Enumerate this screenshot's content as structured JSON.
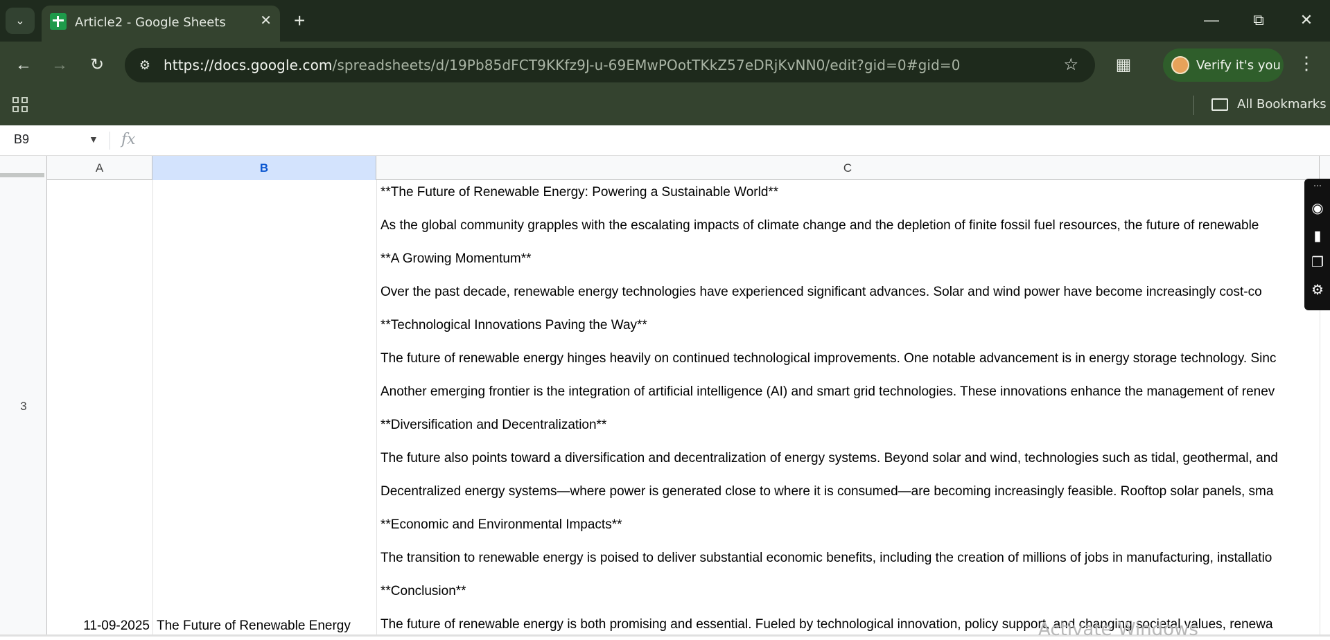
{
  "browser": {
    "tab_title": "Article2 - Google Sheets",
    "url_host": "https://docs.google.com",
    "url_path": "/spreadsheets/d/19Pb85dFCT9KKfz9J-u-69EMwPOotTKkZ57eDRjKvNN0/edit?gid=0#gid=0",
    "verify_label": "Verify it's you",
    "bookmarks_label": "All Bookmarks"
  },
  "sheet": {
    "name_box": "B9",
    "fx_label": "fx",
    "columns": [
      {
        "label": "A"
      },
      {
        "label": "B"
      },
      {
        "label": "C"
      }
    ],
    "row_number": "3",
    "cell_a": "11-09-2025",
    "cell_b": "The Future of Renewable Energy",
    "cell_c_lines": [
      "**The Future of Renewable Energy: Powering a Sustainable World**",
      "As the global community grapples with the escalating impacts of climate change and the depletion of finite fossil fuel resources, the future of renewable",
      "**A Growing Momentum**",
      "Over the past decade, renewable energy technologies have experienced significant advances. Solar and wind power have become increasingly cost-co",
      "**Technological Innovations Paving the Way**",
      "The future of renewable energy hinges heavily on continued technological improvements. One notable advancement is in energy storage technology. Sinc",
      "Another emerging frontier is the integration of artificial intelligence (AI) and smart grid technologies. These innovations enhance the management of renev",
      "**Diversification and Decentralization**",
      "The future also points toward a diversification and decentralization of energy systems. Beyond solar and wind, technologies such as tidal, geothermal, and",
      "Decentralized energy systems—where power is generated close to where it is consumed—are becoming increasingly feasible. Rooftop solar panels, sma",
      "**Economic and Environmental Impacts**",
      "The transition to renewable energy is poised to deliver substantial economic benefits, including the creation of millions of jobs in manufacturing, installatio",
      "**Conclusion**",
      "The future of renewable energy is both promising and essential. Fueled by technological innovation, policy support, and changing societal values, renewa"
    ]
  },
  "overlay": {
    "watermark": "Activate Windows"
  },
  "colors": {
    "chrome_dark": "#1f2b1e",
    "chrome_toolbar": "#34432f",
    "selected_header": "#d3e3fd",
    "sheets_green": "#1e9a4a"
  }
}
